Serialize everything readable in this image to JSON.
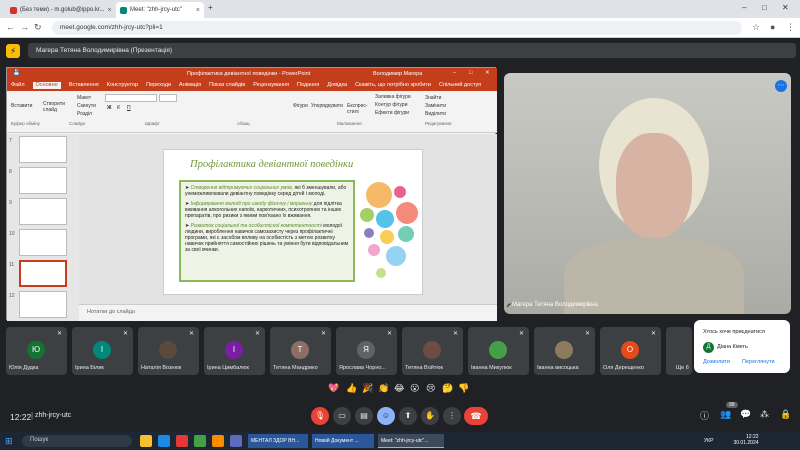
{
  "browser": {
    "tabs": [
      {
        "label": "(Без теми) - m.golub@ippo.kr...",
        "color": "#d93025"
      },
      {
        "label": "Meet: \"zhh-jrcy-utc\"",
        "color": "#00897b"
      }
    ],
    "url": "meet.google.com/zhh-jrcy-utc?pli=1"
  },
  "meet_header": {
    "presenting": "Магера Тетяна Володимирівна (Презентація)"
  },
  "ppt": {
    "title": "Профілактика девіантної поведінки  -  PowerPoint",
    "user": "Володимир Магера",
    "menu": [
      "Файл",
      "Основне",
      "Вставлення",
      "Конструктор",
      "Переходи",
      "Анімація",
      "Показ слайдів",
      "Рецензування",
      "Подання",
      "Довідка",
      "Скажіть, що потрібно зробити",
      "Спільний доступ"
    ],
    "ribbon": {
      "paste": "Вставити",
      "new_slide": "Створити слайд",
      "layout": "Макет",
      "reset": "Скинути",
      "section": "Розділ",
      "shapes": "Фігури",
      "arrange": "Упорядкувати",
      "quick_styles": "Експрес-стилі",
      "fill": "Заливка фігури",
      "outline": "Контур фігури",
      "effects": "Ефекти фігури",
      "find": "Знайти",
      "replace": "Замінити",
      "select": "Виділити",
      "groups": [
        "Буфер обміну",
        "Слайди",
        "Шрифт",
        "Абзац",
        "Малювання",
        "Редагування"
      ]
    },
    "thumb_numbers": [
      "7",
      "8",
      "9",
      "10",
      "11",
      "12"
    ],
    "slide": {
      "title": "Профілактика девіантної поведінки",
      "bullets": [
        {
          "green": "Створення відтримуючих соціальних умов,",
          "text": " які б зменшували, або унеможливлювали девіантну поведінку серед дітей і молоді."
        },
        {
          "green": "Інформування молоді про шкоду фізичну і моральну",
          "text": " для підлітка вживання алкогольних напоїв, наркотичних, психотропних та інших препаратів, про ризики з якими пов'язано їх вживання."
        },
        {
          "green": "Розвиток соціальної та особистісної компетентності",
          "text": " молодої людини, вироблення навичок самозахисту через профілактичні програми, які є засобом впливу на особистість з метою розвитку навичок прийняття самостійних рішень та уміння бути відповідальним за свої вчинки."
        }
      ]
    },
    "notes": "Нотатки до слайда",
    "circle_colors": [
      "#f4a742",
      "#e23b6e",
      "#8dc63f",
      "#2bb3e3",
      "#f26d5b",
      "#6b5fb3",
      "#f9c02d",
      "#4fc3a1",
      "#f08fc0",
      "#7ac7f0",
      "#b5d96b"
    ]
  },
  "speaker": {
    "name": "Магера Тетяна Володимирівна"
  },
  "participants": [
    {
      "initial": "Ю",
      "name": "Юлія Дудка",
      "color": "#137333"
    },
    {
      "initial": "І",
      "name": "Ірина Білик",
      "color": "#00897b"
    },
    {
      "initial": "",
      "name": "Наталія Вознюк",
      "color": "#5a4a3e"
    },
    {
      "initial": "І",
      "name": "Ірина Цимбалюк",
      "color": "#7b1fa2"
    },
    {
      "initial": "Т",
      "name": "Тетяна Мандрико",
      "color": "#8d6e63"
    },
    {
      "initial": "Я",
      "name": "Ярослава Чорно...",
      "color": "#5f6368"
    },
    {
      "initial": "",
      "name": "Тетяна Войтюк",
      "color": "#6d4c41"
    },
    {
      "initial": "",
      "name": "Іванна Микулюк",
      "color": "#43a047"
    },
    {
      "initial": "",
      "name": "Іванна висоцька",
      "color": "#8d7b5f"
    },
    {
      "initial": "О",
      "name": "Оля Дерещенко",
      "color": "#e64a19"
    },
    {
      "initial": "",
      "name": "Ще 6",
      "color": "#3c4043"
    }
  ],
  "popup": {
    "text": "Хтось хоче приєднатися",
    "initial": "Д",
    "name": "Діана Кметь",
    "allow": "Дозволити",
    "view": "Переглянути"
  },
  "reactions": [
    "💖",
    "👍",
    "🎉",
    "👏",
    "😂",
    "😮",
    "😢",
    "🤔",
    "👎"
  ],
  "bottom": {
    "time": "12:22",
    "meeting_code": "zhh-jrcy-utc",
    "participant_count": "99"
  },
  "taskbar": {
    "search": "Пошук",
    "tasks": [
      "МЕНТАЛ ЗДОР ВН...",
      "Новий Документ ...",
      "Meet: \"zhh-jrcy-utc\"..."
    ],
    "lang": "УКР",
    "time": "12:22",
    "date": "30.01.2024"
  }
}
